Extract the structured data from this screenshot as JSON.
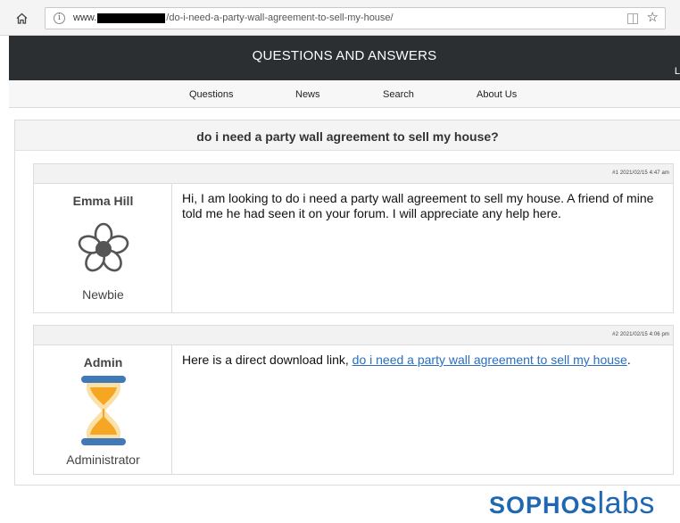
{
  "browser": {
    "url_prefix": "www.",
    "url_path": "/do-i-need-a-party-wall-agreement-to-sell-my-house/",
    "home_icon": "home-icon",
    "info_icon": "info-icon",
    "info_glyph": "i",
    "reader_icon": "reader-view-icon",
    "bookmark_icon": "star-icon"
  },
  "site": {
    "title": "QUESTIONS AND ANSWERS",
    "header_extra": "L",
    "nav": [
      "Questions",
      "News",
      "Search",
      "About Us"
    ]
  },
  "thread": {
    "title": "do i need a party wall agreement to sell my house?",
    "posts": [
      {
        "meta": "#1 2021/02/15 4:47 am",
        "user": "Emma Hill",
        "rank": "Newbie",
        "avatar_icon": "flower-icon",
        "body": "Hi, I am looking to do i need a party wall agreement to sell my house. A friend of mine told me he had seen it on your forum. I will appreciate any help here."
      },
      {
        "meta": "#2 2021/02/15 4:06 pm",
        "user": "Admin",
        "rank": "Administrator",
        "avatar_icon": "hourglass-icon",
        "body_prefix": "Here is a direct download link, ",
        "link_text": "do i need a party wall agreement to sell my house",
        "body_suffix": "."
      }
    ]
  },
  "branding": {
    "sophos": "SOPHOS",
    "labs": "labs",
    "color": "#1f67b1"
  },
  "colors": {
    "header_bg": "#2b2f31",
    "link": "#2a6ebf",
    "hourglass_blue": "#3f79b8",
    "hourglass_sand": "#f5a623"
  }
}
